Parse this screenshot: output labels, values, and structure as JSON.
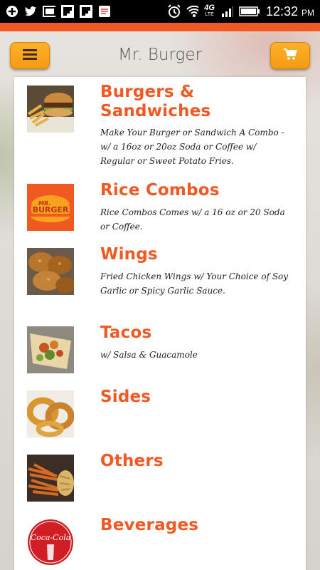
{
  "status_bar": {
    "time": "12:32",
    "ampm": "PM",
    "network": "4G",
    "network_sub": "LTE",
    "icons": [
      "plus-icon",
      "twitter-icon",
      "screen-icon",
      "flipboard-icon",
      "flipboard-icon",
      "notes-icon",
      "alarm-icon",
      "wifi-icon",
      "signal-icon",
      "battery-icon"
    ]
  },
  "header": {
    "title": "Mr. Burger",
    "menu_icon": "hamburger-menu-icon",
    "cart_icon": "shopping-cart-icon",
    "accent": "#f05a22",
    "button_color": "#f7a51d"
  },
  "categories": [
    {
      "title": "Burgers & Sandwiches",
      "description": "Make Your Burger or Sandwich A Combo - w/ a 16oz or 20oz Soda or Coffee w/ Regular or Sweet Potato Fries.",
      "image": "burger-photo"
    },
    {
      "title": "Rice Combos",
      "description": "Rice Combos Comes w/ a 16 oz or 20 Soda or Coffee.",
      "image": "mr-burger-logo",
      "logo_line1": "MR.",
      "logo_line2": "BURGER"
    },
    {
      "title": "Wings",
      "description": "Fried Chicken Wings w/ Your Choice of Soy Garlic or Spicy Garlic Sauce.",
      "image": "wings-photo"
    },
    {
      "title": "Tacos",
      "description": "w/ Salsa & Guacamole",
      "image": "tacos-photo"
    },
    {
      "title": "Sides",
      "description": "",
      "image": "onion-rings-photo"
    },
    {
      "title": "Others",
      "description": "",
      "image": "fries-photo"
    },
    {
      "title": "Beverages",
      "description": "",
      "image": "coca-cola-logo",
      "logo_text": "Coca-Cola"
    }
  ]
}
